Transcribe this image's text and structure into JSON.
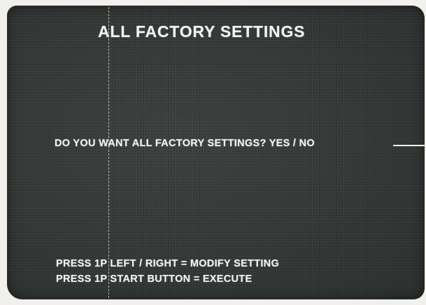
{
  "screen": {
    "title": "ALL  FACTORY SETTINGS",
    "prompt": {
      "question": "DO YOU WANT ALL FACTORY SETTINGS?",
      "options": "YES / NO"
    },
    "instructions": [
      "PRESS 1P LEFT / RIGHT = MODIFY SETTING",
      "PRESS 1P START BUTTON = EXECUTE"
    ]
  },
  "colors": {
    "screen_background": "#323735",
    "text": "#f2f3f0",
    "paper": "#f1f0ec"
  }
}
